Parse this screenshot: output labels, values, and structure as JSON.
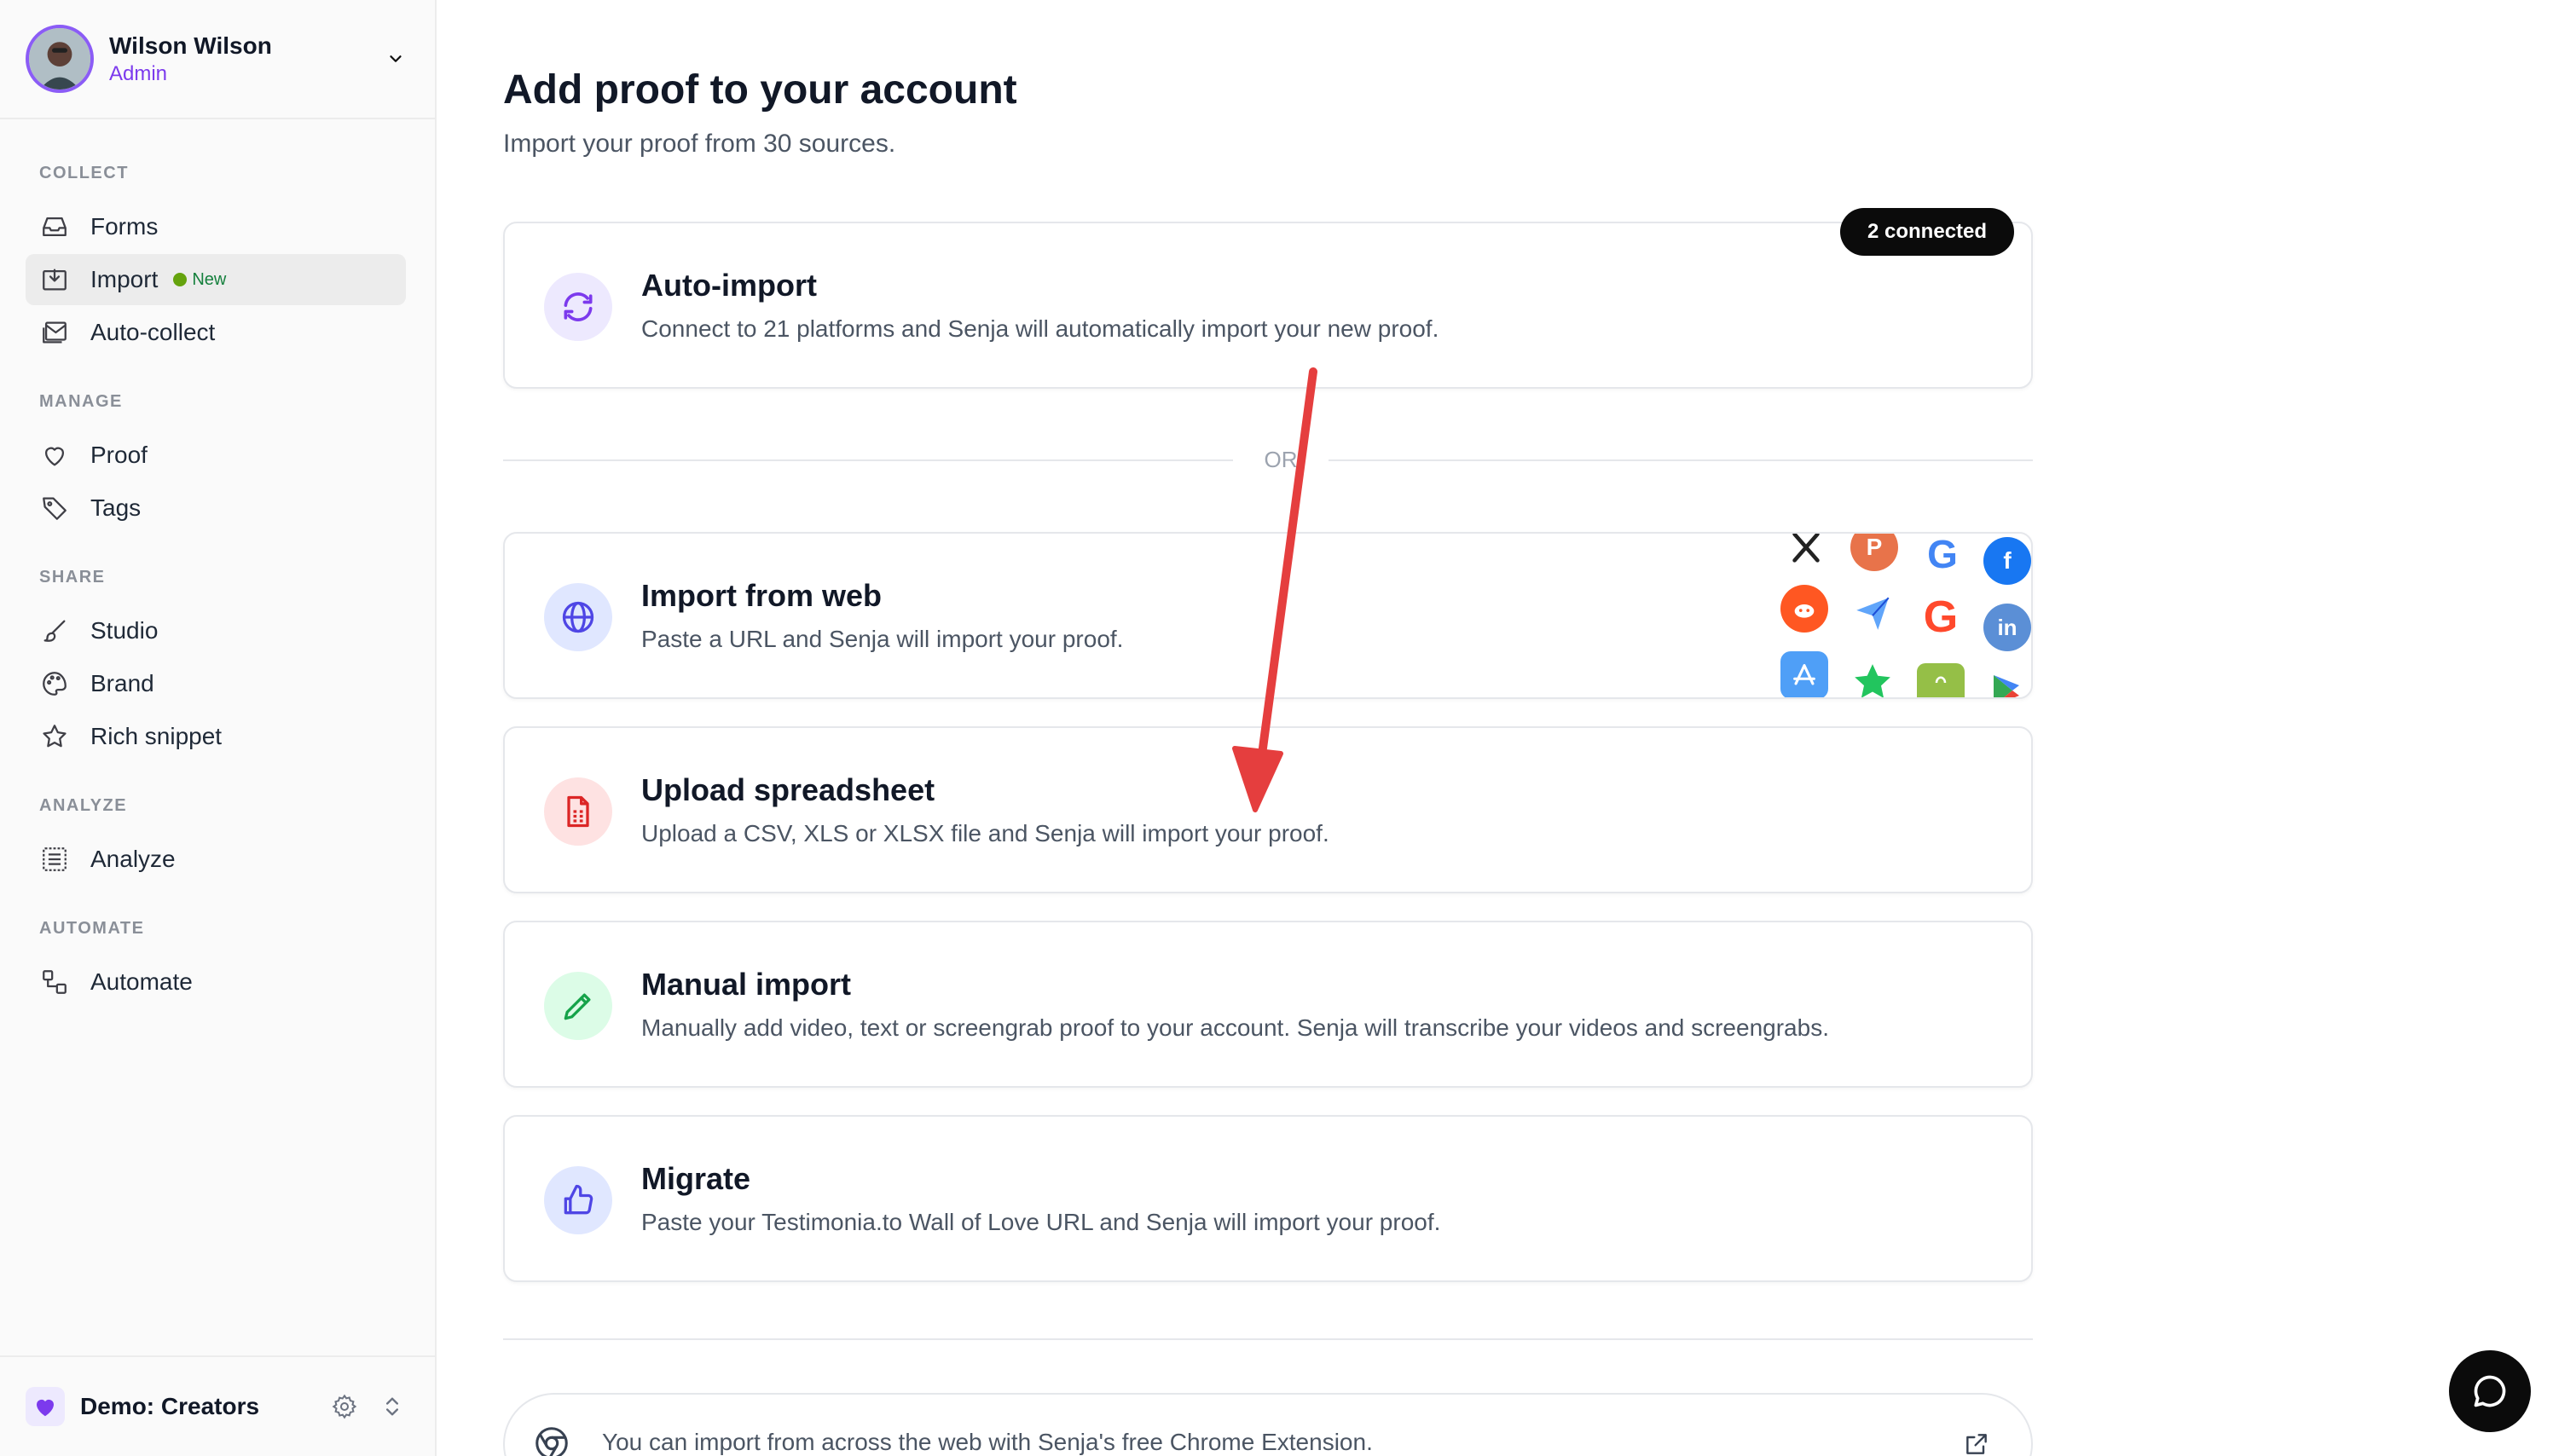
{
  "user": {
    "name": "Wilson Wilson",
    "role": "Admin"
  },
  "sidebar": {
    "sections": {
      "collect": "COLLECT",
      "manage": "MANAGE",
      "share": "SHARE",
      "analyze": "ANALYZE",
      "automate": "AUTOMATE"
    },
    "items": {
      "forms": "Forms",
      "import": "Import",
      "import_badge": "New",
      "auto_collect": "Auto-collect",
      "proof": "Proof",
      "tags": "Tags",
      "studio": "Studio",
      "brand": "Brand",
      "rich_snippet": "Rich snippet",
      "analyze": "Analyze",
      "automate": "Automate"
    },
    "workspace": "Demo: Creators"
  },
  "main": {
    "title": "Add proof to your account",
    "subtitle": "Import your proof from 30 sources.",
    "connected": "2 connected",
    "or": "OR",
    "cards": {
      "auto_import": {
        "title": "Auto-import",
        "desc": "Connect to 21 platforms and Senja will automatically import your new proof."
      },
      "import_web": {
        "title": "Import from web",
        "desc": "Paste a URL and Senja will import your proof."
      },
      "spreadsheet": {
        "title": "Upload spreadsheet",
        "desc": "Upload a CSV, XLS or XLSX file and Senja will import your proof."
      },
      "manual": {
        "title": "Manual import",
        "desc": "Manually add video, text or screengrab proof to your account. Senja will transcribe your videos and screengrabs."
      },
      "migrate": {
        "title": "Migrate",
        "desc": "Paste your Testimonia.to Wall of Love URL and Senja will import your proof."
      }
    },
    "chrome_text": "You can import from across the web with Senja's free Chrome Extension."
  },
  "logos": {
    "producthunt": "P",
    "google": "G",
    "facebook": "f",
    "g2": "G",
    "linkedin": "in"
  },
  "colors": {
    "accent": "#7c3aed",
    "arrow": "#e53e3e",
    "auto_import_bg": "#ede9fe",
    "web_bg": "#e0e7ff",
    "spreadsheet_bg": "#fee2e2",
    "manual_bg": "#dcfce7",
    "migrate_bg": "#e0e7ff"
  }
}
